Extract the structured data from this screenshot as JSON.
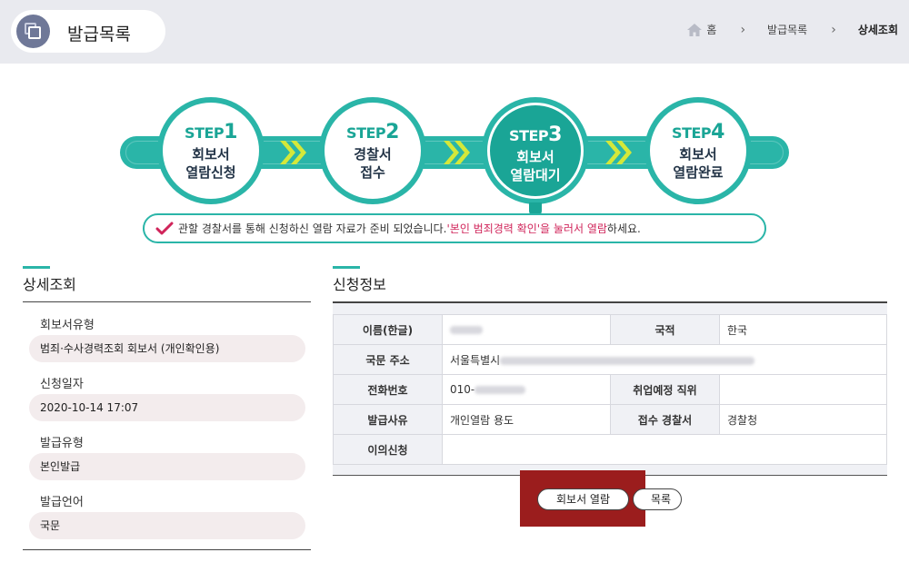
{
  "header": {
    "title": "발급목록",
    "breadcrumb": [
      "홈",
      "발급목록",
      "상세조회"
    ]
  },
  "steps": [
    {
      "label": "STEP",
      "num": "1",
      "name": "회보서\n열람신청",
      "active": false
    },
    {
      "label": "STEP",
      "num": "2",
      "name": "경찰서\n접수",
      "active": false
    },
    {
      "label": "STEP",
      "num": "3",
      "name": "회보서\n열람대기",
      "active": true
    },
    {
      "label": "STEP",
      "num": "4",
      "name": "회보서\n열람완료",
      "active": false
    }
  ],
  "notice": {
    "before": "관할 경찰서를 통해 신청하신 열람 자료가 준비 되었습니다.",
    "highlight": "'본인 범죄경력 확인'을 눌러서 열람",
    "after": "하세요."
  },
  "detail": {
    "title": "상세조회",
    "fields": [
      {
        "label": "회보서유형",
        "value": "범죄·수사경력조회 회보서 (개인확인용)"
      },
      {
        "label": "신청일자",
        "value": "2020-10-14 17:07"
      },
      {
        "label": "발급유형",
        "value": "본인발급"
      },
      {
        "label": "발급언어",
        "value": "국문"
      }
    ]
  },
  "application": {
    "title": "신청정보",
    "name_label": "이름(한글)",
    "nationality_label": "국적",
    "nationality_value": "한국",
    "address_label": "국문 주소",
    "address_value": "서울특별시",
    "phone_label": "전화번호",
    "phone_value": "010-",
    "job_label": "취업예정 직위",
    "job_value": "",
    "reason_label": "발급사유",
    "reason_value": "개인열람 용도",
    "station_label": "접수 경찰서",
    "station_value": "경찰청",
    "objection_label": "이의신청",
    "objection_value": ""
  },
  "buttons": {
    "view": "회보서 열람",
    "list": "목록"
  },
  "colors": {
    "accent": "#2ab5a8",
    "highlight_text": "#d0245a",
    "annotation_box": "#9b1d1d"
  }
}
